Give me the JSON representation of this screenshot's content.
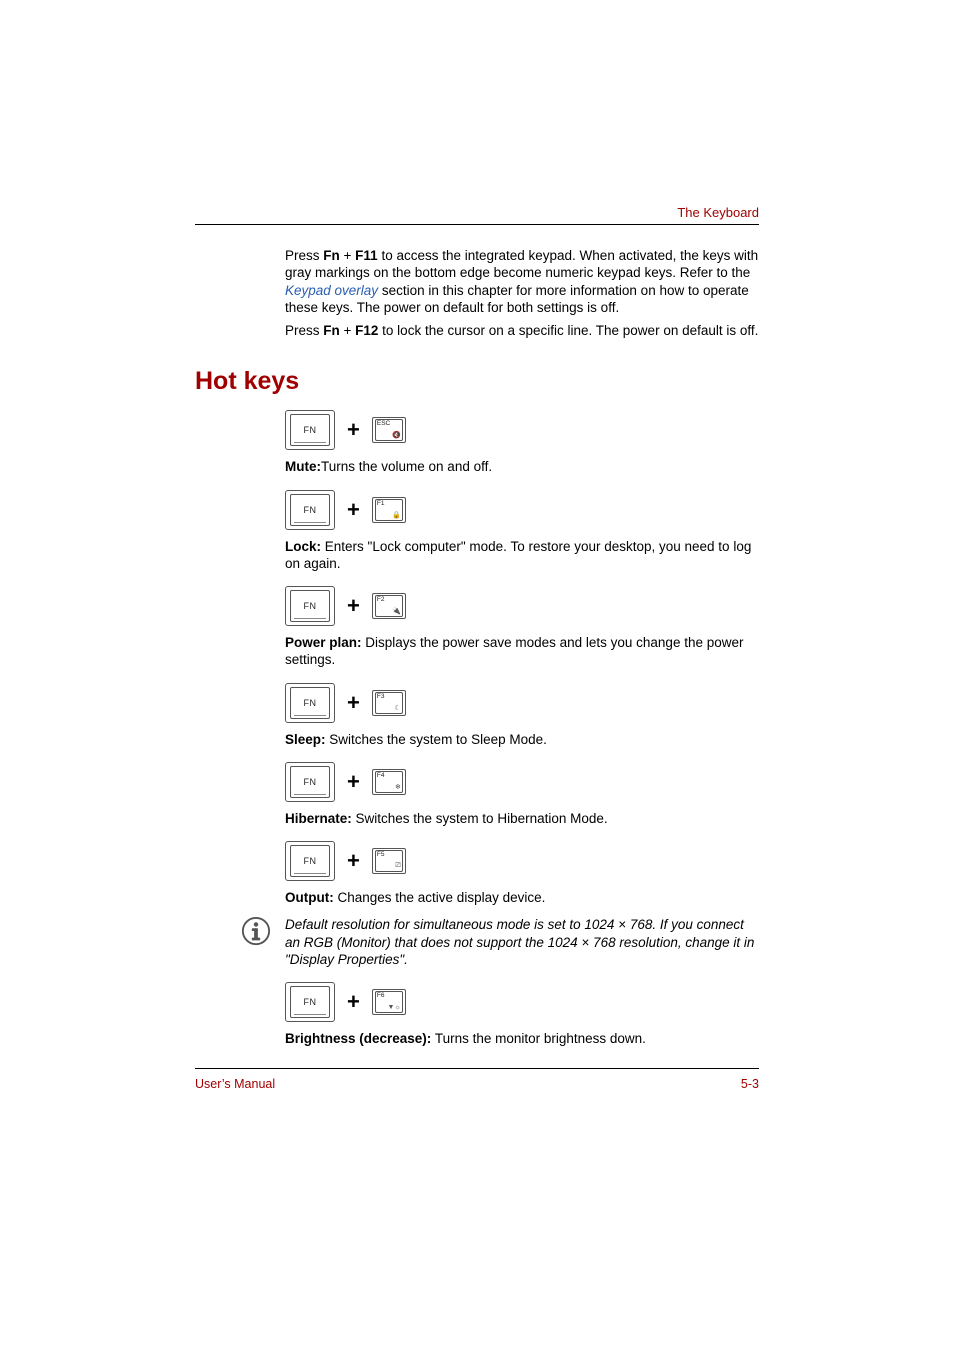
{
  "header": {
    "section_label": "The Keyboard"
  },
  "intro": {
    "p1_pre": "Press ",
    "p1_b1": "Fn",
    "p1_mid1": " + ",
    "p1_b2": "F11",
    "p1_post1": " to access the integrated keypad. When activated, the keys with gray markings on the bottom edge become numeric keypad keys. Refer to the ",
    "p1_link": "Keypad overlay",
    "p1_post2": " section in this chapter for more information on how to operate these keys. The power on default for both settings is off.",
    "p2_pre": "Press ",
    "p2_b1": "Fn",
    "p2_mid1": " + ",
    "p2_b2": "F12",
    "p2_post": " to lock the cursor on a specific line. The power on default is off."
  },
  "section": {
    "heading": "Hot keys"
  },
  "keys": {
    "fn_label": "FN",
    "plus": "+",
    "esc": "ESC",
    "f1": "F1",
    "f2": "F2",
    "f3": "F3",
    "f4": "F4",
    "f5": "F5",
    "f6": "F6"
  },
  "hotkeys": {
    "mute": {
      "bold": "Mute:",
      "text": "Turns the volume on and off."
    },
    "lock": {
      "bold": "Lock:",
      "text": " Enters \"Lock computer\" mode. To restore your desktop, you need to log on again."
    },
    "power": {
      "bold": "Power plan:",
      "text": " Displays the power save modes and lets you change the power settings."
    },
    "sleep": {
      "bold": "Sleep:",
      "text": " Switches the system to Sleep Mode."
    },
    "hiber": {
      "bold": "Hibernate:",
      "text": " Switches the system to Hibernation Mode."
    },
    "output": {
      "bold": "Output:",
      "text": " Changes the active display device."
    },
    "bright": {
      "bold": "Brightness (decrease):",
      "text": " Turns the monitor brightness down."
    }
  },
  "note": {
    "text": "Default resolution for simultaneous mode is set to 1024 × 768. If you connect an RGB (Monitor) that does not support the 1024 × 768 resolution, change it in \"Display Properties\"."
  },
  "footer": {
    "left": "User’s Manual",
    "right": "5-3"
  }
}
